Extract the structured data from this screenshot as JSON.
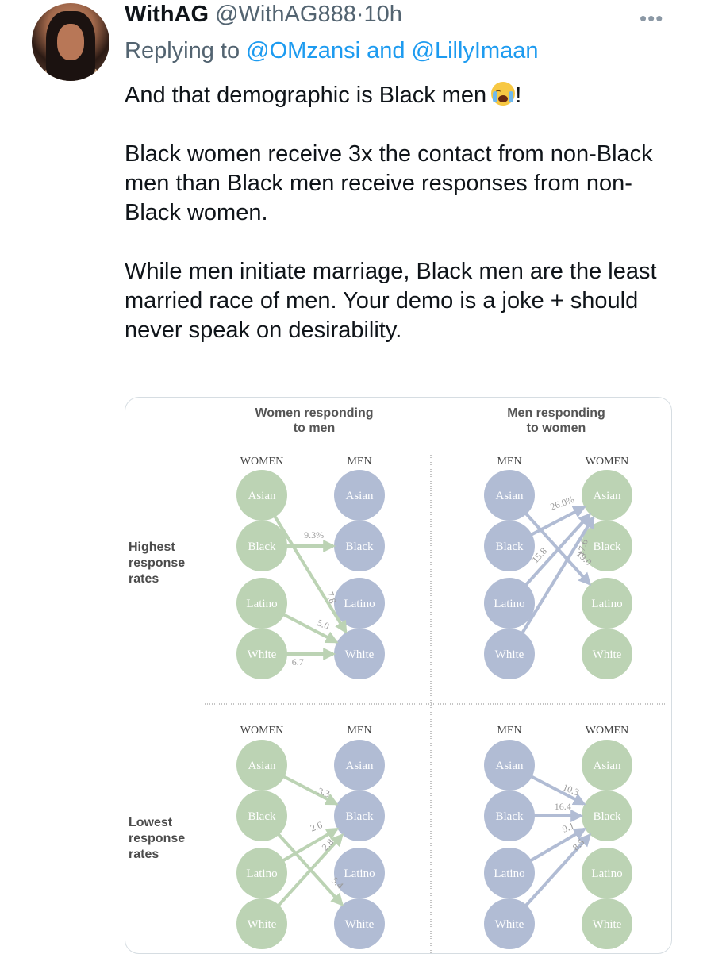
{
  "tweet": {
    "display_name": "WithAG",
    "handle": "@WithAG888",
    "separator": "·",
    "time": "10h",
    "more_icon": "more-horizontal-icon",
    "reply_prefix": "Replying to",
    "reply_targets": "@OMzansi and @LillyImaan",
    "text": [
      "And that demographic is Black men",
      "!",
      "Black women receive 3x the contact from non-Black men than Black men receive responses from non-Black women.",
      "While men initiate marriage, Black men are the least married race of men. Your demo is a joke + should never speak on desirability."
    ],
    "emoji": "loudly-crying-face-emoji"
  },
  "colors": {
    "women": "#bcd3b4",
    "men": "#b1bcd4",
    "arrow_women": "#bcd3b4",
    "arrow_men": "#b1bcd4",
    "link": "#1d9bf0"
  },
  "chart_data": {
    "type": "diagram",
    "column_titles": [
      "Women responding to men",
      "Men responding to women"
    ],
    "row_labels": [
      "Highest response rates",
      "Lowest response rates"
    ],
    "panels": [
      {
        "left_header": "WOMEN",
        "right_header": "MEN",
        "left": [
          "Asian",
          "Black",
          "Latino",
          "White"
        ],
        "right": [
          "Asian",
          "Black",
          "Latino",
          "White"
        ],
        "edges": [
          {
            "from": "Black",
            "to": "Black",
            "value": "9.3%"
          },
          {
            "from": "Asian",
            "to": "White",
            "value": "7.8"
          },
          {
            "from": "Latino",
            "to": "White",
            "value": "5.0"
          },
          {
            "from": "White",
            "to": "White",
            "value": "6.7"
          }
        ]
      },
      {
        "left_header": "MEN",
        "right_header": "WOMEN",
        "left": [
          "Asian",
          "Black",
          "Latino",
          "White"
        ],
        "right": [
          "Asian",
          "Black",
          "Latino",
          "White"
        ],
        "edges": [
          {
            "from": "Black",
            "to": "Asian",
            "value": "26.0%"
          },
          {
            "from": "Latino",
            "to": "Asian",
            "value": "15.8"
          },
          {
            "from": "White",
            "to": "Asian",
            "value": "17.6"
          },
          {
            "from": "Asian",
            "to": "Latino",
            "value": "19.0"
          }
        ]
      },
      {
        "left_header": "WOMEN",
        "right_header": "MEN",
        "left": [
          "Asian",
          "Black",
          "Latino",
          "White"
        ],
        "right": [
          "Asian",
          "Black",
          "Latino",
          "White"
        ],
        "edges": [
          {
            "from": "Asian",
            "to": "Black",
            "value": "3.3"
          },
          {
            "from": "Latino",
            "to": "Black",
            "value": "2.6"
          },
          {
            "from": "White",
            "to": "Black",
            "value": "2.8"
          },
          {
            "from": "Black",
            "to": "White",
            "value": "5.4"
          }
        ]
      },
      {
        "left_header": "MEN",
        "right_header": "WOMEN",
        "left": [
          "Asian",
          "Black",
          "Latino",
          "White"
        ],
        "right": [
          "Asian",
          "Black",
          "Latino",
          "White"
        ],
        "edges": [
          {
            "from": "Asian",
            "to": "Black",
            "value": "10.3"
          },
          {
            "from": "Black",
            "to": "Black",
            "value": "16.4"
          },
          {
            "from": "Latino",
            "to": "Black",
            "value": "9.1"
          },
          {
            "from": "White",
            "to": "Black",
            "value": "8.5"
          }
        ]
      }
    ]
  }
}
